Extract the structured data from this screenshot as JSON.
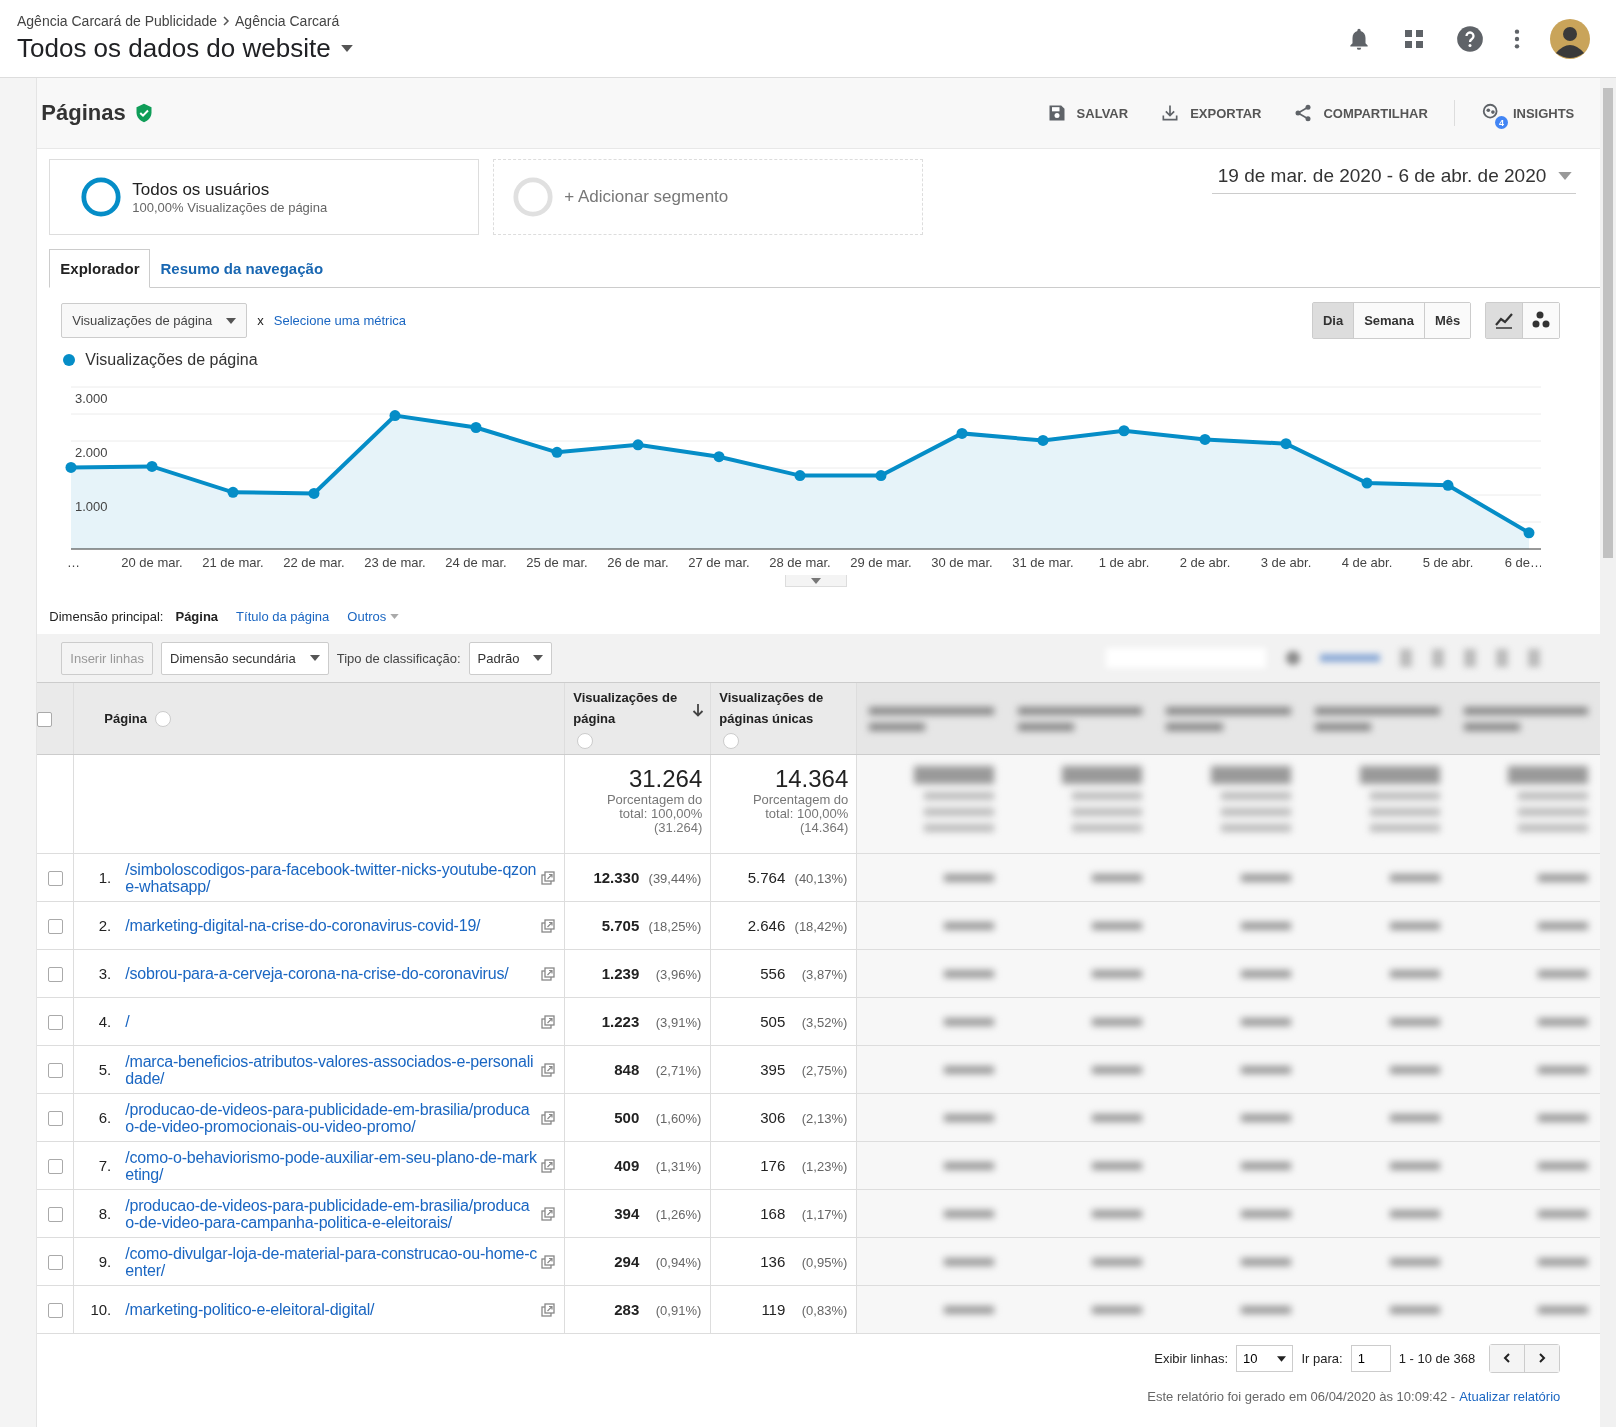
{
  "breadcrumb": [
    "Agência Carcará de Publicidade",
    "Agência Carcará"
  ],
  "view_title": "Todos os dados do website",
  "report": {
    "title": "Páginas",
    "verified": true
  },
  "actions": [
    {
      "label": "SALVAR",
      "kind": "save"
    },
    {
      "label": "EXPORTAR",
      "kind": "export"
    },
    {
      "label": "COMPARTILHAR",
      "kind": "share"
    },
    {
      "label": "INSIGHTS",
      "kind": "insights",
      "badge": "4"
    }
  ],
  "segments": [
    {
      "name": "Todos os usuários",
      "detail": "100,00% Visualizações de página",
      "active": true
    },
    {
      "name": "+ Adicionar segmento",
      "active": false
    }
  ],
  "date_range": "19 de mar. de 2020 - 6 de abr. de 2020",
  "tabs": [
    {
      "label": "Explorador",
      "selected": true
    },
    {
      "label": "Resumo da navegação",
      "selected": false
    }
  ],
  "metric_selector": {
    "value": "Visualizações de página",
    "separator": "x",
    "secondary_link": "Selecione uma métrica"
  },
  "period_buttons": [
    {
      "label": "Dia",
      "selected": true
    },
    {
      "label": "Semana",
      "selected": false
    },
    {
      "label": "Mês",
      "selected": false
    }
  ],
  "chart_type_buttons": [
    {
      "kind": "line",
      "selected": true
    },
    {
      "kind": "motion",
      "selected": false
    }
  ],
  "chart": {
    "chart_data": {
      "type": "area",
      "categories": [
        "…",
        "20 de mar.",
        "21 de mar.",
        "22 de mar.",
        "23 de mar.",
        "24 de mar.",
        "25 de mar.",
        "26 de mar.",
        "27 de mar.",
        "28 de mar.",
        "29 de mar.",
        "30 de mar.",
        "31 de mar.",
        "1 de abr.",
        "2 de abr.",
        "3 de abr.",
        "4 de abr.",
        "5 de abr.",
        "6 de…"
      ],
      "series": [
        {
          "name": "Visualizações de página",
          "color": "#058dc7",
          "values": [
            1510,
            1530,
            1050,
            1030,
            2470,
            2250,
            1790,
            1930,
            1710,
            1360,
            1360,
            2140,
            2010,
            2190,
            2030,
            1950,
            1220,
            1180,
            300
          ]
        }
      ],
      "ylim": [
        0,
        3000
      ],
      "yticks": [
        {
          "value": 1000,
          "label": "1.000"
        },
        {
          "value": 2000,
          "label": "2.000"
        },
        {
          "value": 3000,
          "label": "3.000"
        }
      ]
    }
  },
  "dimension": {
    "label": "Dimensão principal:",
    "options": [
      {
        "label": "Página",
        "selected": true,
        "kind": "option"
      },
      {
        "label": "Título da página",
        "selected": false,
        "kind": "option"
      },
      {
        "label": "Outros",
        "selected": false,
        "kind": "menu"
      }
    ]
  },
  "toolbar": {
    "insert_rows": {
      "label": "Inserir linhas",
      "disabled": true
    },
    "secondary_dimension": "Dimensão secundária",
    "sort_label": "Tipo de classificação:",
    "sort_value": "Padrão"
  },
  "table": {
    "select_all_checked": false,
    "columns": [
      {
        "label": "Página",
        "sorted": false
      },
      {
        "label": "Visualizações de página",
        "sorted": true
      },
      {
        "label": "Visualizações de páginas únicas",
        "sorted": false
      }
    ],
    "totals": [
      {
        "value": "31.264",
        "note_lines": [
          "Porcentagem do",
          "total: 100,00%",
          "(31.264)"
        ]
      },
      {
        "value": "14.364",
        "note_lines": [
          "Porcentagem do",
          "total: 100,00%",
          "(14.364)"
        ]
      }
    ],
    "rows": [
      {
        "index": "1.",
        "page": "/simboloscodigos-para-facebook-twitter-nicks-youtube-qzone-whatsapp/",
        "pageviews": "12.330",
        "pageviews_pct": "(39,44%)",
        "unique": "5.764",
        "unique_pct": "(40,13%)",
        "checked": false
      },
      {
        "index": "2.",
        "page": "/marketing-digital-na-crise-do-coronavirus-covid-19/",
        "pageviews": "5.705",
        "pageviews_pct": "(18,25%)",
        "unique": "2.646",
        "unique_pct": "(18,42%)",
        "checked": false
      },
      {
        "index": "3.",
        "page": "/sobrou-para-a-cerveja-corona-na-crise-do-coronavirus/",
        "pageviews": "1.239",
        "pageviews_pct": "(3,96%)",
        "unique": "556",
        "unique_pct": "(3,87%)",
        "checked": false
      },
      {
        "index": "4.",
        "page": "/",
        "pageviews": "1.223",
        "pageviews_pct": "(3,91%)",
        "unique": "505",
        "unique_pct": "(3,52%)",
        "checked": false
      },
      {
        "index": "5.",
        "page": "/marca-beneficios-atributos-valores-associados-e-personalidade/",
        "pageviews": "848",
        "pageviews_pct": "(2,71%)",
        "unique": "395",
        "unique_pct": "(2,75%)",
        "checked": false
      },
      {
        "index": "6.",
        "page": "/producao-de-videos-para-publicidade-em-brasilia/producao-de-video-promocionais-ou-video-promo/",
        "pageviews": "500",
        "pageviews_pct": "(1,60%)",
        "unique": "306",
        "unique_pct": "(2,13%)",
        "checked": false
      },
      {
        "index": "7.",
        "page": "/como-o-behaviorismo-pode-auxiliar-em-seu-plano-de-marketing/",
        "pageviews": "409",
        "pageviews_pct": "(1,31%)",
        "unique": "176",
        "unique_pct": "(1,23%)",
        "checked": false
      },
      {
        "index": "8.",
        "page": "/producao-de-videos-para-publicidade-em-brasilia/producao-de-video-para-campanha-politica-e-eleitorais/",
        "pageviews": "394",
        "pageviews_pct": "(1,26%)",
        "unique": "168",
        "unique_pct": "(1,17%)",
        "checked": false
      },
      {
        "index": "9.",
        "page": "/como-divulgar-loja-de-material-para-construcao-ou-home-center/",
        "pageviews": "294",
        "pageviews_pct": "(0,94%)",
        "unique": "136",
        "unique_pct": "(0,95%)",
        "checked": false
      },
      {
        "index": "10.",
        "page": "/marketing-politico-e-eleitoral-digital/",
        "pageviews": "283",
        "pageviews_pct": "(0,91%)",
        "unique": "119",
        "unique_pct": "(0,83%)",
        "checked": false
      }
    ]
  },
  "pagination": {
    "rows_label": "Exibir linhas:",
    "rows_value": "10",
    "goto_label": "Ir para:",
    "goto_value": "1",
    "range": "1 - 10 de 368"
  },
  "footer": {
    "text": "Este relatório foi gerado em 06/04/2020 às 10:09:42 -",
    "link": "Atualizar relatório"
  }
}
